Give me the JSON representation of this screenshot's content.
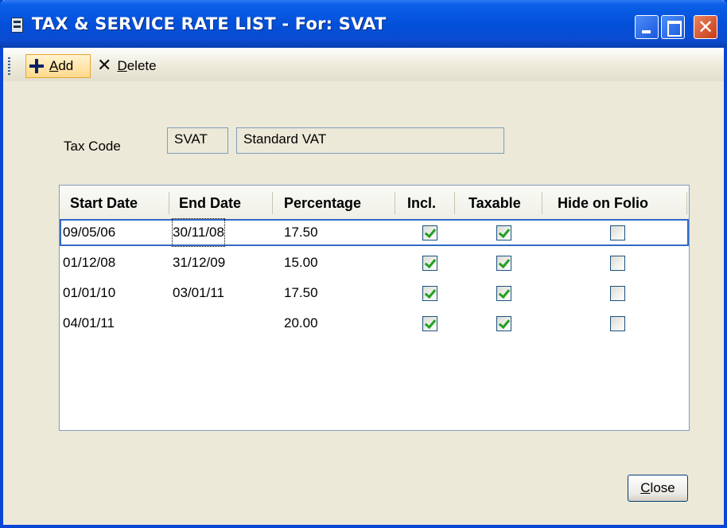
{
  "window": {
    "title": "TAX & SERVICE RATE LIST - For: SVAT",
    "controls": [
      "minimize",
      "maximize",
      "close"
    ]
  },
  "toolbar": {
    "add_accel": "A",
    "add_rest": "dd",
    "delete_accel": "D",
    "delete_rest": "elete",
    "icons": [
      "plus-icon",
      "x-icon"
    ]
  },
  "form": {
    "tax_code_label": "Tax Code",
    "tax_code_value": "SVAT",
    "tax_description": "Standard VAT"
  },
  "grid": {
    "headers": [
      "Start Date",
      "End Date",
      "Percentage",
      "Incl.",
      "Taxable",
      "Hide on Folio"
    ],
    "rows": [
      {
        "start_date": "09/05/06",
        "end_date": "30/11/08",
        "percentage": "17.50",
        "incl": true,
        "taxable": true,
        "hide_on_folio": false
      },
      {
        "start_date": "01/12/08",
        "end_date": "31/12/09",
        "percentage": "15.00",
        "incl": true,
        "taxable": true,
        "hide_on_folio": false
      },
      {
        "start_date": "01/01/10",
        "end_date": "03/01/11",
        "percentage": "17.50",
        "incl": true,
        "taxable": true,
        "hide_on_folio": false
      },
      {
        "start_date": "04/01/11",
        "end_date": "",
        "percentage": "20.00",
        "incl": true,
        "taxable": true,
        "hide_on_folio": false
      }
    ],
    "selected_row": 0
  },
  "footer": {
    "close_accel": "C",
    "close_rest": "lose"
  },
  "colors": {
    "titlebar": "#0350da",
    "window_bg": "#ece9d8",
    "selection": "#316ac5",
    "check": "#21a121"
  }
}
